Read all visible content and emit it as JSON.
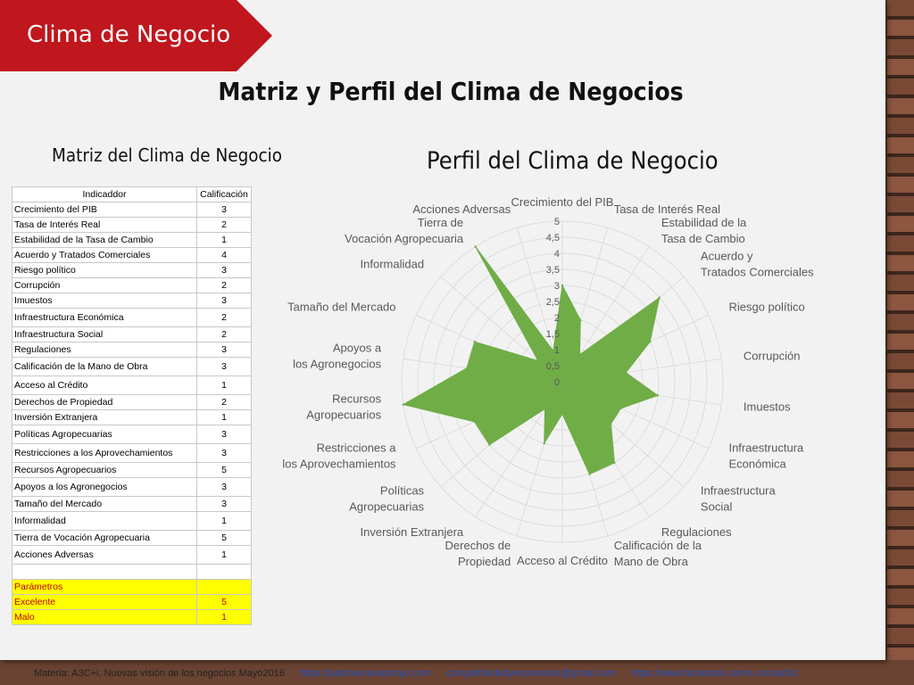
{
  "banner": {
    "label": "Clima de Negocio",
    "color": "#c0161d"
  },
  "main_title": "Matriz y Perfil del Clima de Negocios",
  "matrix": {
    "title": "Matriz del Clima de Negocio",
    "headers": [
      "Indicaddor",
      "Calificación"
    ],
    "rows": [
      [
        "Crecimiento del PIB",
        "3"
      ],
      [
        "Tasa de Interés Real",
        "2"
      ],
      [
        "Estabilidad de la Tasa de Cambio",
        "1"
      ],
      [
        "Acuerdo y Tratados Comerciales",
        "4"
      ],
      [
        "Riesgo político",
        "3"
      ],
      [
        "Corrupción",
        "2"
      ],
      [
        "Imuestos",
        "3"
      ],
      [
        "Infraestructura Económica",
        "2"
      ],
      [
        "Infraestructura Social",
        "2"
      ],
      [
        "Regulaciones",
        "3"
      ],
      [
        "Calificación de la Mano de Obra",
        "3"
      ],
      [
        "Acceso al Crédito",
        "1"
      ],
      [
        "Derechos de Propiedad",
        "2"
      ],
      [
        "Inversión Extranjera",
        "1"
      ],
      [
        "Políticas Agropecuarias",
        "3"
      ],
      [
        "Restricciones a los Aprovechamientos",
        "3"
      ],
      [
        "Recursos Agropecuarios",
        "5"
      ],
      [
        "Apoyos a los Agronegocios",
        "3"
      ],
      [
        "Tamaño del Mercado",
        "3"
      ],
      [
        "Informalidad",
        "1"
      ],
      [
        "Tierra de Vocación Agropecuaria",
        "5"
      ],
      [
        "Acciones Adversas",
        "1"
      ]
    ],
    "params_label": "Parámetros",
    "params": [
      [
        "Excelente",
        "5"
      ],
      [
        "Malo",
        "1"
      ]
    ]
  },
  "chart_data": {
    "type": "radar",
    "title": "Perfil del Clima de Negocio",
    "fill_color": "#70ad47",
    "categories": [
      "Crecimiento del PIB",
      "Tasa de Interés Real",
      "Estabilidad de la Tasa de Cambio",
      "Acuerdo y Tratados Comerciales",
      "Riesgo político",
      "Corrupción",
      "Imuestos",
      "Infraestructura Económica",
      "Infraestructura Social",
      "Regulaciones",
      "Calificación de la Mano de Obra",
      "Acceso al Crédito",
      "Derechos de Propiedad",
      "Inversión Extranjera",
      "Políticas Agropecuarias",
      "Restricciones a los Aprovechamientos",
      "Recursos Agropecuarios",
      "Apoyos a los Agronegocios",
      "Tamaño del Mercado",
      "Informalidad",
      "Tierra de Vocación Agropecuaria",
      "Acciones Adversas"
    ],
    "values": [
      3,
      2,
      1,
      4,
      3,
      2,
      3,
      2,
      2,
      3,
      3,
      1,
      2,
      1,
      3,
      3,
      5,
      3,
      3,
      1,
      5,
      1
    ],
    "rlim": [
      0,
      5
    ],
    "ticks": [
      "0",
      "0,5",
      "1",
      "1,5",
      "2",
      "2,5",
      "3",
      "3,5",
      "4",
      "4,5",
      "5"
    ]
  },
  "footer": {
    "text": "Materia: A3C+i. Nuevas visión de los negocios Mayo2016",
    "links": [
      "https://pabloseraviatorojo.com",
      "competitividadyescenarios@gmail.com",
      "https://www.facebook.com/e.consult3c"
    ]
  }
}
